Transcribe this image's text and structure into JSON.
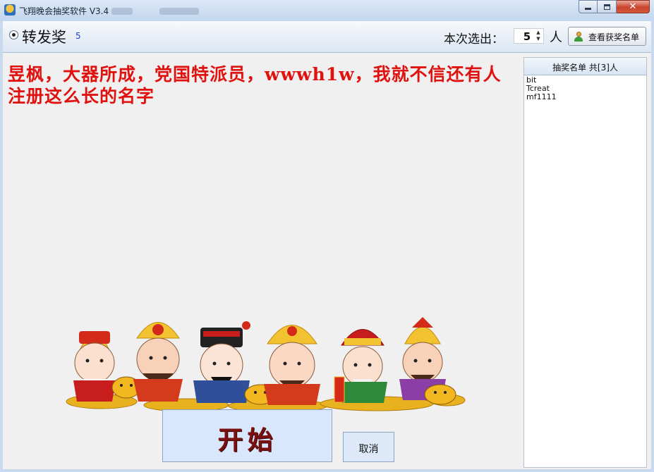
{
  "window": {
    "title": "飞翔晚会抽奖软件 V3.4",
    "minimize_glyph": "–",
    "maximize_glyph": "□",
    "close_glyph": "✕"
  },
  "header": {
    "prize_name": "转发奖",
    "prize_count": "5",
    "pick_label": "本次选出：",
    "pick_value": "5",
    "pick_unit": "人",
    "view_winners_label": "查看获奖名单"
  },
  "main": {
    "winner_text": "昱枫，大器所成，党国特派员，wwwh1w，我就不信还有人注册这么长的名字",
    "start_label": "开始",
    "cancel_label": "取消"
  },
  "winners_list": {
    "header": "抽奖名单 共[3]人",
    "items": [
      "bit",
      "Tcreat",
      "mf1111"
    ]
  },
  "colors": {
    "accent_red": "#e0120f",
    "start_text": "#7a1010",
    "prize_count_blue": "#1f3fd1"
  },
  "icons": [
    "app-icon",
    "user-icon",
    "radio-selected",
    "spin-arrows"
  ]
}
